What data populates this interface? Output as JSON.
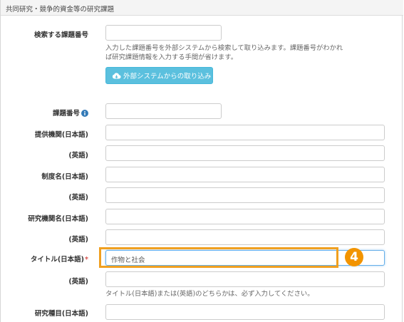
{
  "panel": {
    "title": "共同研究・競争的資金等の研究課題"
  },
  "search": {
    "label": "検索する課題番号",
    "value": "",
    "help_line1": "入力した課題番号を外部システムから検索して取り込みます。課題番号がわかれ",
    "help_line2": "ば研究課題情報を入力する手間が省けます。",
    "import_button_label": "外部システムからの取り込み",
    "import_icon": "cloud-download-icon"
  },
  "form": {
    "task_number": {
      "label": "課題番号",
      "value": "",
      "info_icon": "info-circle-icon"
    },
    "provider_ja": {
      "label": "提供機関(日本語)",
      "value": ""
    },
    "provider_en": {
      "label": "(英語)",
      "value": ""
    },
    "system_ja": {
      "label": "制度名(日本語)",
      "value": ""
    },
    "system_en": {
      "label": "(英語)",
      "value": ""
    },
    "institution_ja": {
      "label": "研究機関名(日本語)",
      "value": ""
    },
    "institution_en": {
      "label": "(英語)",
      "value": ""
    },
    "title_ja": {
      "label": "タイトル(日本語)",
      "required_mark": "*",
      "value": "作物と社会"
    },
    "title_en": {
      "label": "(英語)",
      "value": ""
    },
    "title_help": "タイトル(日本語)または(英語)のどちらかは、必ず入力してください。",
    "category_ja": {
      "label": "研究種目(日本語)"
    }
  },
  "annotation": {
    "step_number": "4",
    "color": "#f29400"
  },
  "colors": {
    "button_bg": "#5bc0de",
    "highlight": "#f0a020",
    "required": "#d9534f"
  }
}
